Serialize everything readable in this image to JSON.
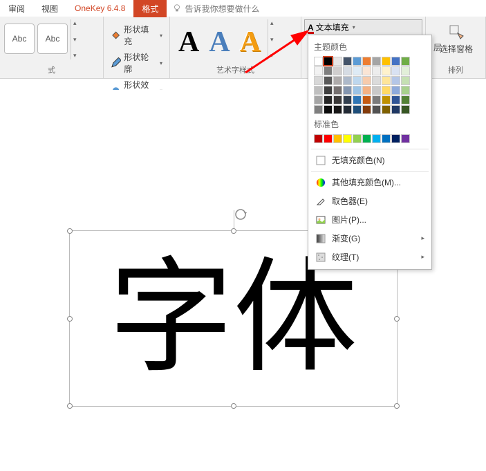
{
  "tabs": {
    "review": "审阅",
    "view": "视图",
    "onekey": "OneKey 6.4.8",
    "format": "格式",
    "tellme": "告诉我你想要做什么"
  },
  "shape_styles": {
    "abc": "Abc",
    "fill": "形状填充",
    "outline": "形状轮廓",
    "effects": "形状效果",
    "group_label": "式"
  },
  "wordart": {
    "letter": "A",
    "group_label": "艺术字样式",
    "text_fill": "文本填充"
  },
  "arrange": {
    "layer": "层",
    "select_pane": "选择窗格",
    "group_label": "排列"
  },
  "dropdown": {
    "theme_colors": "主题颜色",
    "standard_colors": "标准色",
    "no_fill": "无填充颜色(N)",
    "more_colors": "其他填充颜色(M)...",
    "eyedropper": "取色器(E)",
    "picture": "图片(P)...",
    "gradient": "渐变(G)",
    "texture": "纹理(T)"
  },
  "theme_palette": {
    "row0": [
      "#ffffff",
      "#000000",
      "#e7e6e6",
      "#44546a",
      "#5b9bd5",
      "#ed7d31",
      "#a5a5a5",
      "#ffc000",
      "#4472c4",
      "#70ad47"
    ],
    "row1": [
      "#f2f2f2",
      "#7f7f7f",
      "#d0cece",
      "#d6dce4",
      "#deebf6",
      "#fbe5d5",
      "#ededed",
      "#fff2cc",
      "#d9e2f3",
      "#e2efd9"
    ],
    "row2": [
      "#d8d8d8",
      "#595959",
      "#aeabab",
      "#adb9ca",
      "#bdd7ee",
      "#f7cbac",
      "#dbdbdb",
      "#fee599",
      "#b4c6e7",
      "#c5e0b3"
    ],
    "row3": [
      "#bfbfbf",
      "#3f3f3f",
      "#757070",
      "#8496b0",
      "#9cc3e5",
      "#f4b183",
      "#c9c9c9",
      "#ffd965",
      "#8eaadb",
      "#a8d08d"
    ],
    "row4": [
      "#a5a5a5",
      "#262626",
      "#3a3838",
      "#323f4f",
      "#2e75b5",
      "#c55a11",
      "#7b7b7b",
      "#bf9000",
      "#2f5496",
      "#538135"
    ],
    "row5": [
      "#7f7f7f",
      "#0c0c0c",
      "#171616",
      "#222a35",
      "#1e4e79",
      "#833c0b",
      "#525252",
      "#7f6000",
      "#1f3864",
      "#375623"
    ]
  },
  "standard_palette": [
    "#c00000",
    "#ff0000",
    "#ffc000",
    "#ffff00",
    "#92d050",
    "#00b050",
    "#00b0f0",
    "#0070c0",
    "#002060",
    "#7030a0"
  ],
  "textbox": {
    "content": "字体"
  }
}
